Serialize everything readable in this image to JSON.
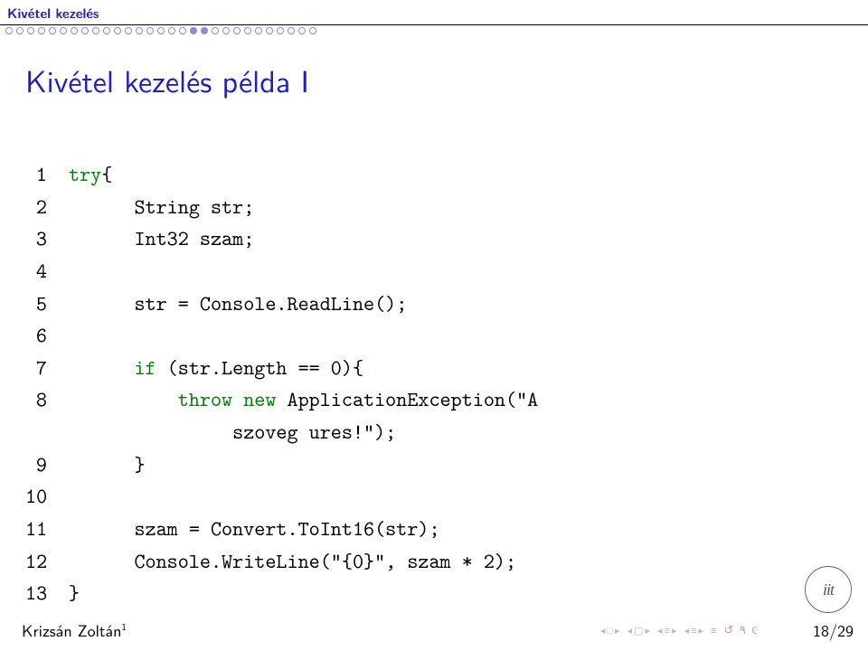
{
  "header": {
    "section": "Kivétel kezelés",
    "progress": "ooooooooooooooooo..ooooooooooo",
    "total_dots": 29,
    "current_start": 18,
    "current_end": 19
  },
  "title": "Kivétel kezelés példa I",
  "code": {
    "lines": [
      {
        "n": "1",
        "kw": "try",
        "rest": "{"
      },
      {
        "n": "2",
        "indent": "      ",
        "text": "String str;"
      },
      {
        "n": "3",
        "indent": "      ",
        "text": "Int32 szam;"
      },
      {
        "n": "4",
        "text": ""
      },
      {
        "n": "5",
        "indent": "      ",
        "text": "str = Console.ReadLine();"
      },
      {
        "n": "6",
        "text": ""
      },
      {
        "n": "7",
        "indent": "      ",
        "kw": "if",
        "rest": " (str.Length == 0){"
      },
      {
        "n": "8",
        "indent": "          ",
        "kw": "throw new",
        "rest": " ApplicationException(\"A"
      },
      {
        "n": "",
        "indent": "               ",
        "text": "szoveg ures!\");"
      },
      {
        "n": "9",
        "indent": "      ",
        "text": "}"
      },
      {
        "n": "10",
        "text": ""
      },
      {
        "n": "11",
        "indent": "      ",
        "text": "szam = Convert.ToInt16(str);"
      },
      {
        "n": "12",
        "indent": "      ",
        "text": "Console.WriteLine(\"{0}\", szam * 2);"
      },
      {
        "n": "13",
        "text": "}"
      }
    ]
  },
  "footer": {
    "author": "Krizsán Zoltán",
    "author_sup": "1",
    "page": "18/29"
  },
  "logo_text": "iit"
}
